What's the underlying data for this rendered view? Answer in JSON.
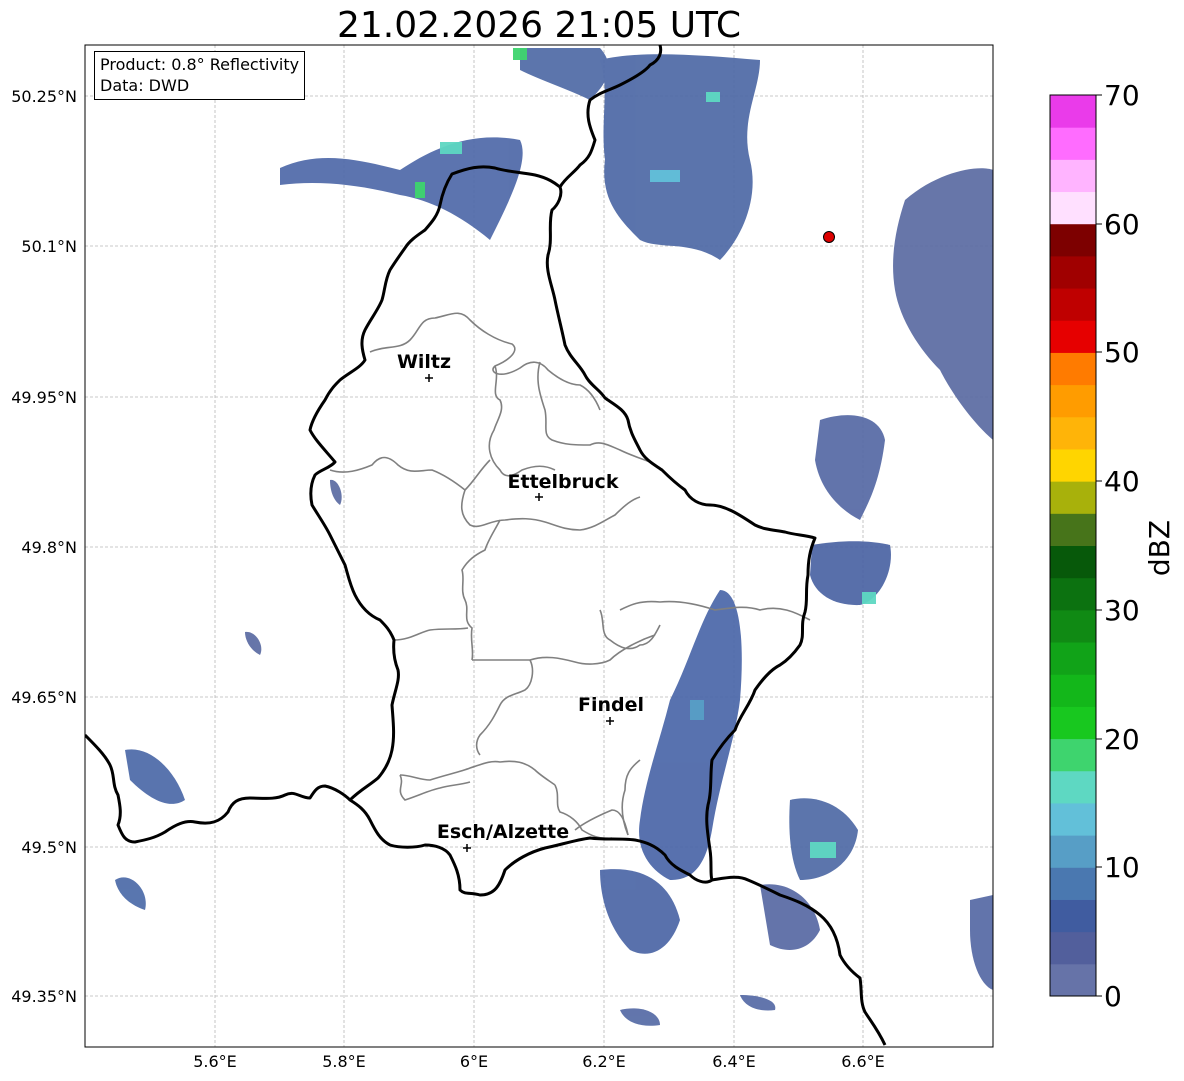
{
  "title": "21.02.2026 21:05 UTC",
  "info": {
    "product": "Product: 0.8° Reflectivity",
    "data": "Data: DWD"
  },
  "axes": {
    "lat_labels": [
      "50.25°N",
      "50.1°N",
      "49.95°N",
      "49.8°N",
      "49.65°N",
      "49.5°N",
      "49.35°N"
    ],
    "lon_labels": [
      "5.6°E",
      "5.8°E",
      "6°E",
      "6.2°E",
      "6.4°E",
      "6.6°E"
    ]
  },
  "cities": [
    {
      "name": "Wiltz"
    },
    {
      "name": "Ettelbruck"
    },
    {
      "name": "Findel"
    },
    {
      "name": "Esch/Alzette"
    }
  ],
  "colorbar": {
    "unit": "dBZ",
    "ticks": [
      "0",
      "10",
      "20",
      "30",
      "40",
      "50",
      "60",
      "70"
    ],
    "colors": [
      "#6673a8",
      "#525f9c",
      "#405ca0",
      "#4a78b0",
      "#579ec6",
      "#62c0d9",
      "#5ed8c2",
      "#3ed46e",
      "#18c81f",
      "#13b71a",
      "#11a318",
      "#108a14",
      "#0c7210",
      "#07590a",
      "#47741a",
      "#a8b10b",
      "#ffd500",
      "#ffb408",
      "#ff9c00",
      "#ff7b00",
      "#e60000",
      "#bf0000",
      "#a00000",
      "#7d0000",
      "#ffe0ff",
      "#ffb4ff",
      "#ff6cff",
      "#ea3bea"
    ]
  },
  "marker": {
    "color": "#dd0000"
  }
}
